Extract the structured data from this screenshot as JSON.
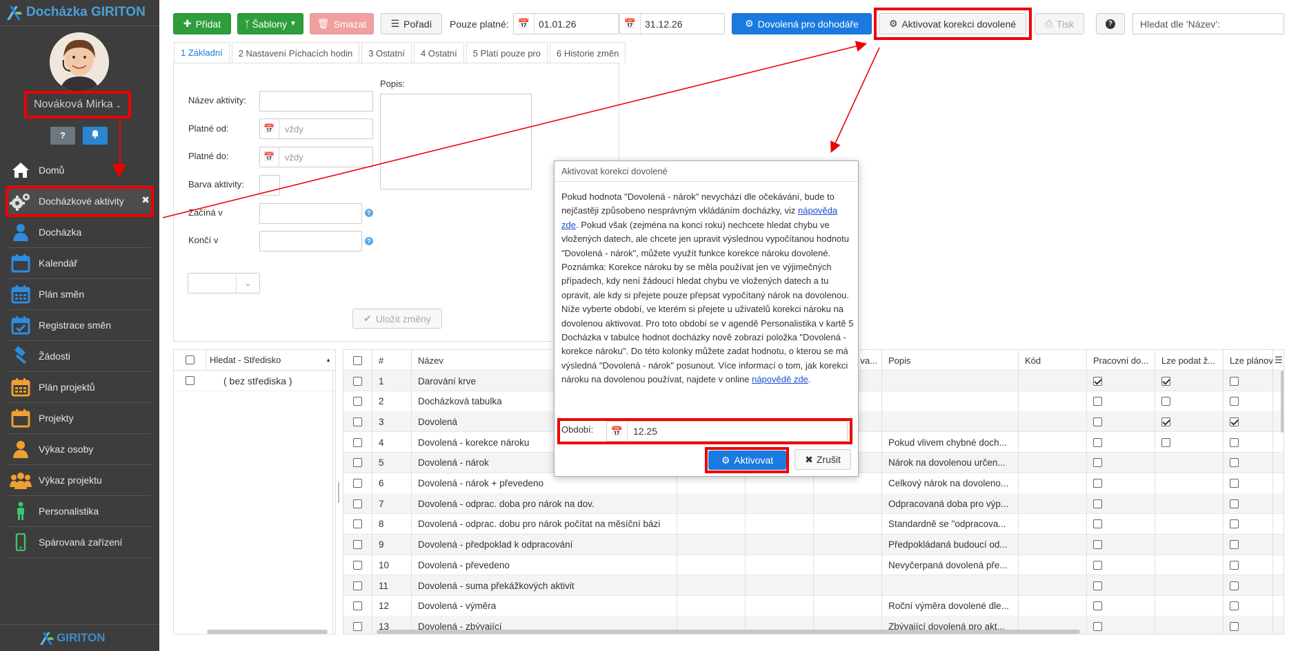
{
  "app": {
    "title": "Docházka GIRITON",
    "footer_brand": "GIRITON"
  },
  "user": {
    "name": "Nováková Mirka"
  },
  "sidebar": {
    "help_label": "?",
    "items": [
      {
        "label": "Domů",
        "icon": "home-icon"
      },
      {
        "label": "Docházkové aktivity",
        "icon": "gears-icon",
        "active": true
      },
      {
        "label": "Docházka",
        "icon": "person-icon"
      },
      {
        "label": "Kalendář",
        "icon": "calendar-icon"
      },
      {
        "label": "Plán směn",
        "icon": "calendar-grid-icon"
      },
      {
        "label": "Registrace směn",
        "icon": "calendar-check-icon"
      },
      {
        "label": "Žádosti",
        "icon": "gavel-icon"
      },
      {
        "label": "Plán projektů",
        "icon": "calendar-plan-icon"
      },
      {
        "label": "Projekty",
        "icon": "calendar-projects-icon"
      },
      {
        "label": "Výkaz osoby",
        "icon": "person-report-icon"
      },
      {
        "label": "Výkaz projektu",
        "icon": "group-icon"
      },
      {
        "label": "Personalistika",
        "icon": "person-standing-icon"
      },
      {
        "label": "Spárovaná zařízení",
        "icon": "phone-icon"
      }
    ]
  },
  "toolbar": {
    "add": "Přidat",
    "templates": "Šablony",
    "delete": "Smazat",
    "order": "Pořadí",
    "valid_only": "Pouze platné:",
    "date_from": "01.01.26",
    "date_to": "31.12.26",
    "vacation_contractors": "Dovolená pro dohodáře",
    "activate_correction": "Aktivovat korekci dovolené",
    "print": "Tisk",
    "help": "?",
    "search_placeholder": "Hledat dle 'Název':"
  },
  "tabs": [
    "1 Základní",
    "2 Nastavení Píchacích hodin",
    "3 Ostatní",
    "4 Ostatní",
    "5 Platí pouze pro",
    "6 Historie změn"
  ],
  "form": {
    "name_label": "Název aktivity:",
    "valid_from_label": "Platné od:",
    "valid_from_placeholder": "vždy",
    "valid_to_label": "Platné do:",
    "valid_to_placeholder": "vždy",
    "color_label": "Barva aktivity:",
    "starts_label": "Začíná v",
    "ends_label": "Končí v",
    "description_label": "Popis:",
    "save": "Uložit změny"
  },
  "left_grid": {
    "header": "Hledat - Středisko",
    "rows": [
      "( bez střediska )"
    ]
  },
  "main_grid": {
    "headers": [
      "#",
      "Název",
      "va...",
      "Popis",
      "Kód",
      "Pracovní do...",
      "Lze podat ž...",
      "Lze plánov"
    ],
    "rows": [
      {
        "n": "1",
        "name": "Darování krve",
        "popis": "",
        "c1": true,
        "c2": true,
        "c3": false
      },
      {
        "n": "2",
        "name": "Docházková tabulka",
        "popis": "",
        "c1": false,
        "c2": false,
        "c3": false
      },
      {
        "n": "3",
        "name": "Dovolená",
        "popis": "",
        "c1": false,
        "c2": true,
        "c3": true
      },
      {
        "n": "4",
        "name": "Dovolená - korekce nároku",
        "popis": "Pokud vlivem chybné doch...",
        "c1": false,
        "c2": false,
        "c3": false
      },
      {
        "n": "5",
        "name": "Dovolená - nárok",
        "popis": "Nárok na dovolenou určen...",
        "c1": false,
        "c2": null,
        "c3": false
      },
      {
        "n": "6",
        "name": "Dovolená - nárok + převedeno",
        "popis": "Celkový nárok na dovoleno...",
        "c1": false,
        "c2": null,
        "c3": false
      },
      {
        "n": "7",
        "name": "Dovolená - odprac. doba pro nárok na dov.",
        "popis": "Odpracovaná doba pro výp...",
        "c1": false,
        "c2": null,
        "c3": false
      },
      {
        "n": "8",
        "name": "Dovolená - odprac. dobu pro nárok počítat na měsíční bázi",
        "popis": "Standardně se \"odpracova...",
        "c1": false,
        "c2": null,
        "c3": false
      },
      {
        "n": "9",
        "name": "Dovolená - předpoklad k odpracování",
        "popis": "Předpokládaná budoucí od...",
        "c1": false,
        "c2": null,
        "c3": false
      },
      {
        "n": "10",
        "name": "Dovolená - převedeno",
        "popis": "Nevyčerpaná dovolená pře...",
        "c1": false,
        "c2": null,
        "c3": false
      },
      {
        "n": "11",
        "name": "Dovolená - suma překážkových aktivit",
        "popis": "",
        "c1": false,
        "c2": null,
        "c3": false
      },
      {
        "n": "12",
        "name": "Dovolená - výměra",
        "popis": "Roční výměra dovolené dle...",
        "c1": false,
        "c2": null,
        "c3": false
      },
      {
        "n": "13",
        "name": "Dovolená - zbývající",
        "popis": "Zbývající dovolená pro akt...",
        "c1": false,
        "c2": null,
        "c3": false
      }
    ]
  },
  "dialog": {
    "title": "Aktivovat korekci dovolené",
    "p1": "Pokud hodnota \"Dovolená - nárok\" nevychází dle očekávání, bude to nejčastěji způsobeno nesprávným vkládáním docházky, viz ",
    "link1": "nápověda zde",
    "p2": ". Pokud však (zejména na konci roku) nechcete hledat chybu ve vložených datech, ale chcete jen upravit výslednou vypočítanou hodnotu \"Dovolená - nárok\", můžete využít funkce korekce nároku dovolené. Poznámka: Korekce nároku by se měla používat jen ve výjimečných případech, kdy není žádoucí hledat chybu ve vložených datech a tu opravit, ale kdy si přejete pouze přepsat vypočítaný nárok na dovolenou. Níže vyberte období, ve kterém si přejete u uživatelů korekci nároku na dovolenou aktivovat. Pro toto období se v agendě Personalistika v kartě 5 Docházka v tabulce hodnot docházky nově zobrazí položka \"Dovolená - korekce nároku\". Do této kolonky můžete zadat hodnotu, o kterou se má výsledná \"Dovolená - nárok\" posunout. Více informací o tom, jak korekci nároku na dovolenou používat, najdete v online ",
    "link2": "nápovědě zde",
    "p3": ".",
    "period_label": "Období:",
    "period_value": "12.25",
    "activate": "Aktivovat",
    "cancel": "Zrušit"
  }
}
